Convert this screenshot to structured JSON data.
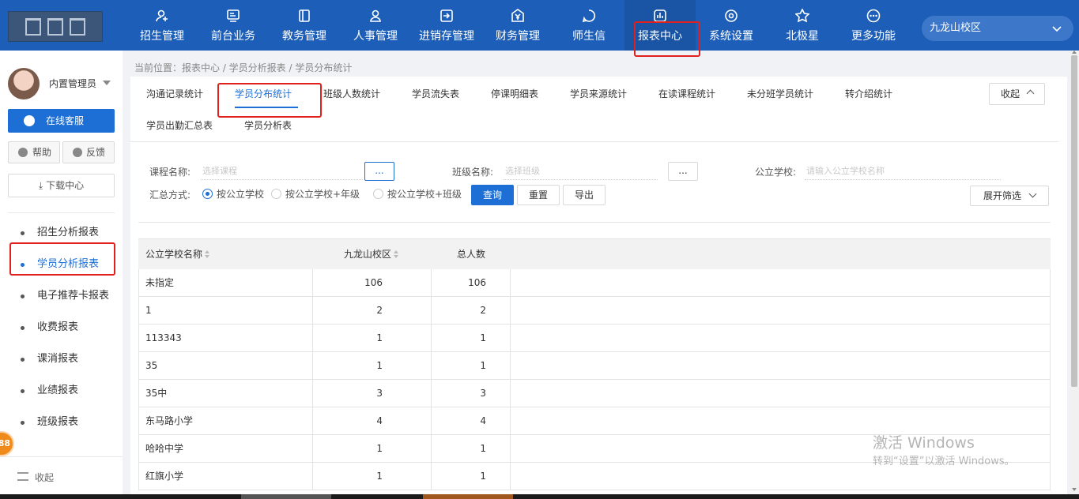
{
  "nav": {
    "items": [
      {
        "label": "招生管理",
        "icon": "user-add-icon"
      },
      {
        "label": "前台业务",
        "icon": "monitor-icon"
      },
      {
        "label": "教务管理",
        "icon": "book-icon"
      },
      {
        "label": "人事管理",
        "icon": "person-icon"
      },
      {
        "label": "进销存管理",
        "icon": "arrow-box-icon"
      },
      {
        "label": "财务管理",
        "icon": "yen-icon"
      },
      {
        "label": "师生信",
        "icon": "chat-icon"
      },
      {
        "label": "报表中心",
        "icon": "chart-icon"
      },
      {
        "label": "系统设置",
        "icon": "settings-icon"
      },
      {
        "label": "北极星",
        "icon": "star-icon"
      },
      {
        "label": "更多功能",
        "icon": "more-icon"
      }
    ],
    "active": "报表中心",
    "campus": "九龙山校区"
  },
  "sidebar": {
    "user": "内置管理员",
    "online_service": "在线客服",
    "help": "帮助",
    "feedback": "反馈",
    "download": "下载中心",
    "items": [
      "招生分析报表",
      "学员分析报表",
      "电子推荐卡报表",
      "收费报表",
      "课消报表",
      "业绩报表",
      "班级报表"
    ],
    "active": "学员分析报表",
    "collapse": "收起",
    "badge": "88"
  },
  "breadcrumb": "当前位置：报表中心 / 学员分析报表 / 学员分布统计",
  "tabs": {
    "row1": [
      "沟通记录统计",
      "学员分布统计",
      "班级人数统计",
      "学员流失表",
      "停课明细表",
      "学员来源统计",
      "在读课程统计",
      "未分班学员统计",
      "转介绍统计"
    ],
    "row2": [
      "学员出勤汇总表",
      "学员分析表"
    ],
    "active": "学员分布统计",
    "collapse": "收起"
  },
  "filters": {
    "course_label": "课程名称:",
    "course_placeholder": "选择课程",
    "class_label": "班级名称:",
    "class_placeholder": "选择班级",
    "school_label": "公立学校:",
    "school_placeholder": "请输入公立学校名称",
    "ellipsis": "...",
    "summary_label": "汇总方式:",
    "radios": [
      "按公立学校",
      "按公立学校+年级",
      "按公立学校+班级"
    ],
    "radio_selected": "按公立学校",
    "query": "查询",
    "reset": "重置",
    "export": "导出",
    "expand": "展开筛选"
  },
  "table": {
    "headers": [
      "公立学校名称",
      "九龙山校区",
      "总人数"
    ],
    "rows": [
      [
        "未指定",
        "106",
        "106"
      ],
      [
        "1",
        "2",
        "2"
      ],
      [
        "113343",
        "1",
        "1"
      ],
      [
        "35",
        "1",
        "1"
      ],
      [
        "35中",
        "3",
        "3"
      ],
      [
        "东马路小学",
        "4",
        "4"
      ],
      [
        "哈哈中学",
        "1",
        "1"
      ],
      [
        "红旗小学",
        "1",
        "1"
      ]
    ]
  },
  "watermark": {
    "line1": "激活 Windows",
    "line2": "转到“设置”以激活 Windows。"
  }
}
